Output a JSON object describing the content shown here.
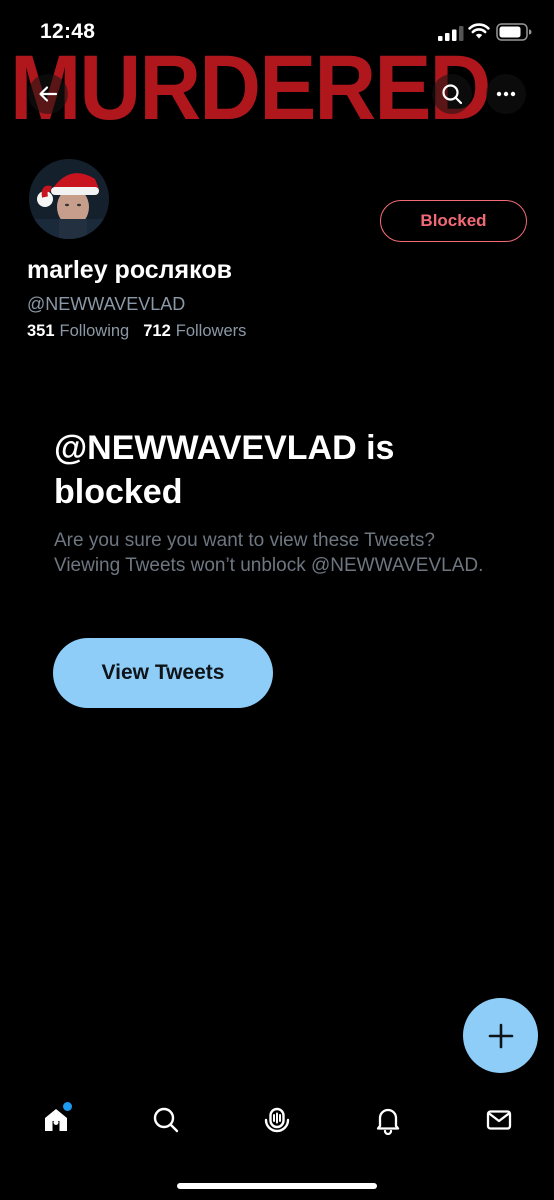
{
  "status_bar": {
    "time": "12:48"
  },
  "banner": {
    "overlay_text": "MURDERED",
    "overlay_color": "#b0171c"
  },
  "nav": {
    "back_icon": "arrow-left-icon",
    "search_icon": "search-icon",
    "more_icon": "more-horizontal-icon"
  },
  "profile": {
    "display_name": "marley росляков",
    "handle": "@NEWWAVEVLAD",
    "following_count": "351",
    "following_label": "Following",
    "followers_count": "712",
    "followers_label": "Followers",
    "blocked_button_label": "Blocked",
    "blocked_color": "#f26a76"
  },
  "blocked_notice": {
    "heading": "@NEWWAVEVLAD is blocked",
    "body": "Are you sure you want to view these Tweets? Viewing Tweets won’t unblock @NEWWAVEVLAD.",
    "button_label": "View Tweets",
    "accent_color": "#8ecdf8"
  },
  "fab": {
    "icon": "plus-icon"
  },
  "tab_bar": {
    "items": [
      {
        "name": "home",
        "icon": "home-icon"
      },
      {
        "name": "search",
        "icon": "search-icon"
      },
      {
        "name": "spaces",
        "icon": "spaces-icon"
      },
      {
        "name": "notifications",
        "icon": "bell-icon"
      },
      {
        "name": "messages",
        "icon": "mail-icon"
      }
    ]
  }
}
